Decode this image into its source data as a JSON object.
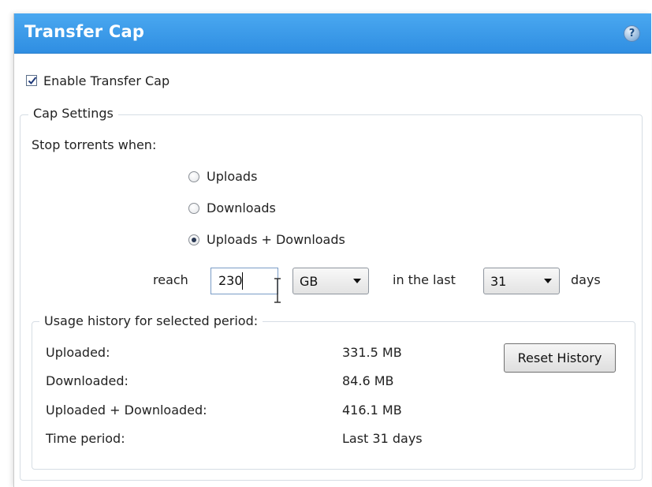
{
  "header": {
    "title": "Transfer Cap",
    "help_icon": "question-mark-icon",
    "help_glyph": "?"
  },
  "enable": {
    "label": "Enable Transfer Cap",
    "checked": true
  },
  "cap_settings": {
    "legend": "Cap Settings",
    "stop_label": "Stop torrents when:",
    "options": [
      {
        "label": "Uploads",
        "selected": false
      },
      {
        "label": "Downloads",
        "selected": false
      },
      {
        "label": "Uploads + Downloads",
        "selected": true
      }
    ],
    "reach_label": "reach",
    "amount_value": "230",
    "unit_value": "GB",
    "in_last_label": "in the last",
    "days_value": "31",
    "days_label": "days"
  },
  "usage": {
    "legend": "Usage history for selected period:",
    "rows": [
      {
        "label": "Uploaded:",
        "value": "331.5 MB"
      },
      {
        "label": "Downloaded:",
        "value": "84.6 MB"
      },
      {
        "label": "Uploaded + Downloaded:",
        "value": "416.1 MB"
      },
      {
        "label": "Time period:",
        "value": "Last 31 days"
      }
    ],
    "reset_label": "Reset History"
  },
  "colors": {
    "title_bar": "#3a9be8",
    "title_text": "#ffffff",
    "border": "#d6dde4"
  }
}
